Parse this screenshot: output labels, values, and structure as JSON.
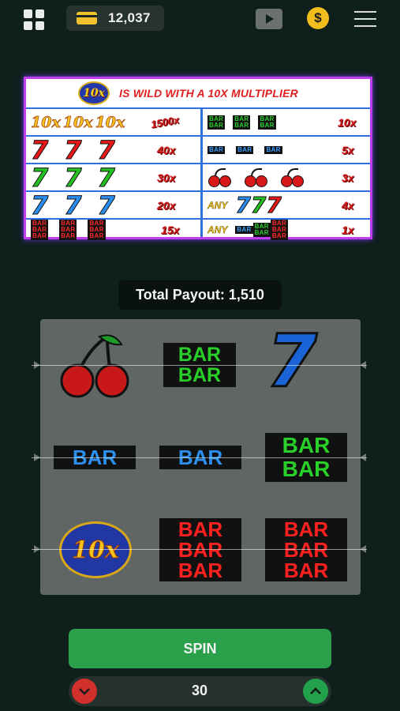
{
  "top_bar": {
    "balance": "12,037",
    "coin_symbol": "$",
    "icons": [
      "grid-menu-icon",
      "card-icon",
      "video-icon",
      "dollar-coin-icon",
      "hamburger-menu-icon"
    ]
  },
  "paytable": {
    "wild_badge": "10x",
    "header_text": "IS WILD WITH A 10X MULTIPLIER",
    "left_rows": [
      {
        "symbol": "10x 10x 10x",
        "payout": "1500x"
      },
      {
        "symbol": "red 7 7 7",
        "payout": "40x"
      },
      {
        "symbol": "green 7 7 7",
        "payout": "30x"
      },
      {
        "symbol": "blue 7 7 7",
        "payout": "20x"
      },
      {
        "symbol": "red triple bar",
        "payout": "15x"
      }
    ],
    "right_rows": [
      {
        "symbol": "green double bar",
        "payout": "10x"
      },
      {
        "symbol": "blue single bar",
        "payout": "5x"
      },
      {
        "symbol": "cherries",
        "payout": "3x"
      },
      {
        "symbol": "any 7 7 7",
        "any_label": "ANY",
        "payout": "4x"
      },
      {
        "symbol": "any bar",
        "any_label": "ANY",
        "payout": "1x"
      }
    ],
    "seven_glyph": "7",
    "bar_text": "BAR"
  },
  "payout": {
    "text": "Total Payout: 1,510"
  },
  "reels": {
    "grid": [
      [
        "cherry",
        "double-bar-green",
        "seven-blue"
      ],
      [
        "single-bar-blue",
        "single-bar-blue",
        "double-bar-green"
      ],
      [
        "tenx-wild",
        "triple-bar-red",
        "triple-bar-red"
      ]
    ],
    "tenx_label": "10x",
    "bar_label": "BAR",
    "seven_label": "7",
    "colors": {
      "green": "#29d029",
      "blue": "#2b8ff0",
      "red": "#ff2020",
      "seven": "#1a64d8"
    }
  },
  "controls": {
    "spin_label": "SPIN",
    "bet_value": "30",
    "minus_icon": "chevron-down-icon",
    "plus_icon": "chevron-up-icon"
  }
}
